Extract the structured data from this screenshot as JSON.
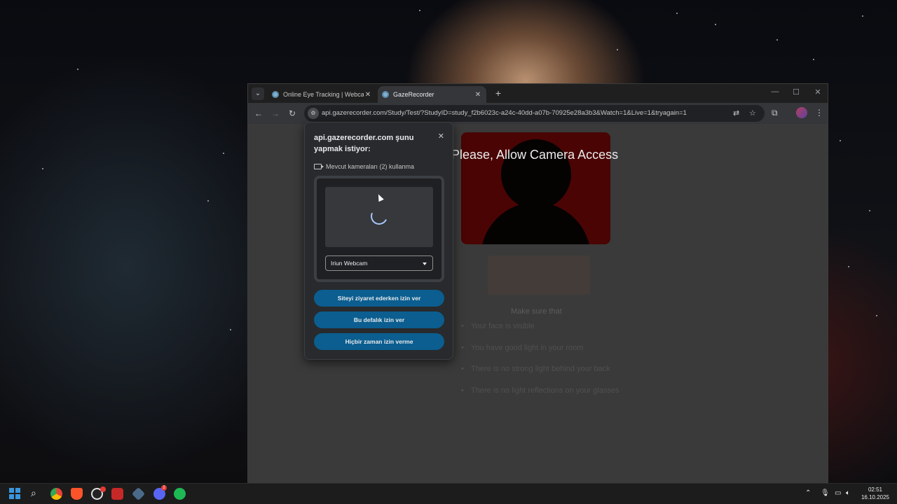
{
  "browser": {
    "tabs": [
      {
        "title": "Online Eye Tracking | Webcam Eye Tracking",
        "active": false
      },
      {
        "title": "GazeRecorder",
        "active": true
      }
    ],
    "new_tab_symbol": "+",
    "url": "api.gazerecorder.com/Study/Test/?StudyID=study_f2b6023c-a24c-40dd-a07b-70925e28a3b3&Watch=1&Live=1&tryagain=1"
  },
  "page": {
    "heading": "Please, Allow Camera Access",
    "make_sure": "Make sure that",
    "tips": [
      "Your face is visible",
      "You have good light in your room",
      "There is no strong light behind your back",
      "There is no light reflections on your glasses"
    ],
    "camera_bg_color": "#4a0404"
  },
  "permission_popup": {
    "title": "api.gazerecorder.com şunu yapmak istiyor:",
    "permission": "Mevcut kameraları (2) kullanma",
    "camera_select": "Iriun Webcam",
    "buttons": {
      "allow_while_visiting": "Siteyi ziyaret ederken izin ver",
      "allow_this_time": "Bu defalık izin ver",
      "never_allow": "Hiçbir zaman izin verme"
    },
    "button_color": "#0b5e8f"
  },
  "taskbar": {
    "time": "02:51",
    "date": "16.10.2025",
    "discord_badge": "2"
  }
}
